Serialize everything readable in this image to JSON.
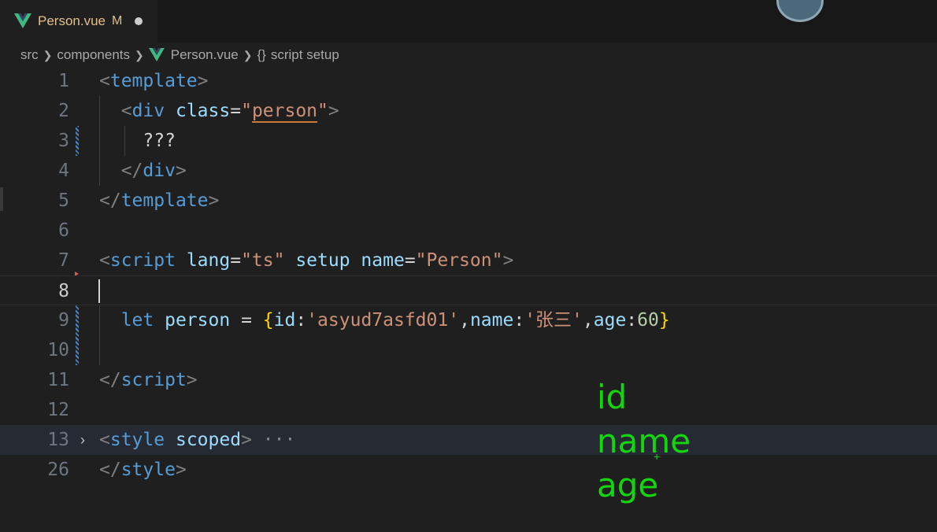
{
  "tab": {
    "filename": "Person.vue",
    "status": "M"
  },
  "breadcrumb": {
    "items": [
      "src",
      "components",
      "Person.vue",
      "script setup"
    ],
    "braces": "{}"
  },
  "gutter": {
    "line_numbers": [
      "1",
      "2",
      "3",
      "4",
      "5",
      "6",
      "7",
      "8",
      "9",
      "10",
      "11",
      "12",
      "13",
      "26"
    ]
  },
  "code": {
    "l1": {
      "lt": "<",
      "tag": "template",
      "gt": ">"
    },
    "l2": {
      "lt": "<",
      "tag": "div",
      "attr": "class",
      "eq": "=",
      "q1": "\"",
      "val": "person",
      "q2": "\"",
      "gt": ">"
    },
    "l3": {
      "text": "???"
    },
    "l4": {
      "lt": "</",
      "tag": "div",
      "gt": ">"
    },
    "l5": {
      "lt": "</",
      "tag": "template",
      "gt": ">"
    },
    "l7": {
      "lt": "<",
      "tag": "script",
      "a1": "lang",
      "v1": "\"ts\"",
      "a2": "setup",
      "a3": "name",
      "v3": "\"Person\"",
      "eq": "=",
      "gt": ">"
    },
    "l9": {
      "kw": "let",
      "var": "person",
      "op": "=",
      "ob": "{",
      "k1": "id",
      "v1": "'asyud7asfd01'",
      "k2": "name",
      "v2": "'张三'",
      "k3": "age",
      "v3": "60",
      "colon": ":",
      "comma": ",",
      "cb": "}"
    },
    "l11": {
      "lt": "</",
      "tag": "script",
      "gt": ">"
    },
    "l13": {
      "lt": "<",
      "tag": "style",
      "attr": "scoped",
      "gt": ">",
      "ellipsis": "···"
    },
    "l26": {
      "lt": "</",
      "tag": "style",
      "gt": ">"
    }
  },
  "annotation": {
    "words": [
      "id",
      "name",
      "age"
    ],
    "color": "#14d60f"
  }
}
